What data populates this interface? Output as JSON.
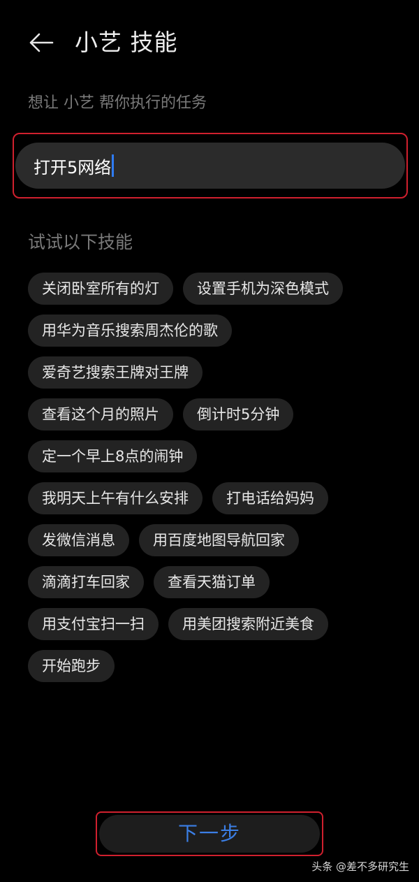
{
  "header": {
    "title": "小艺 技能",
    "back_icon": "arrow-left-icon"
  },
  "task": {
    "label": "想让 小艺 帮你执行的任务",
    "input_value": "打开5网络"
  },
  "suggestions": {
    "heading": "试试以下技能",
    "rows": [
      [
        "关闭卧室所有的灯",
        "设置手机为深色模式"
      ],
      [
        "用华为音乐搜索周杰伦的歌"
      ],
      [
        "爱奇艺搜索王牌对王牌"
      ],
      [
        "查看这个月的照片",
        "倒计时5分钟"
      ],
      [
        "定一个早上8点的闹钟"
      ],
      [
        "我明天上午有什么安排",
        "打电话给妈妈"
      ],
      [
        "发微信消息",
        "用百度地图导航回家"
      ],
      [
        "滴滴打车回家",
        "查看天猫订单"
      ],
      [
        "用支付宝扫一扫",
        "用美团搜索附近美食"
      ],
      [
        "开始跑步"
      ]
    ]
  },
  "footer": {
    "next_label": "下一步"
  },
  "watermark": "头条 @差不多研究生",
  "colors": {
    "background": "#000000",
    "accent": "#3b7fe6",
    "highlight": "#d0202e",
    "chip_bg": "#232323"
  }
}
